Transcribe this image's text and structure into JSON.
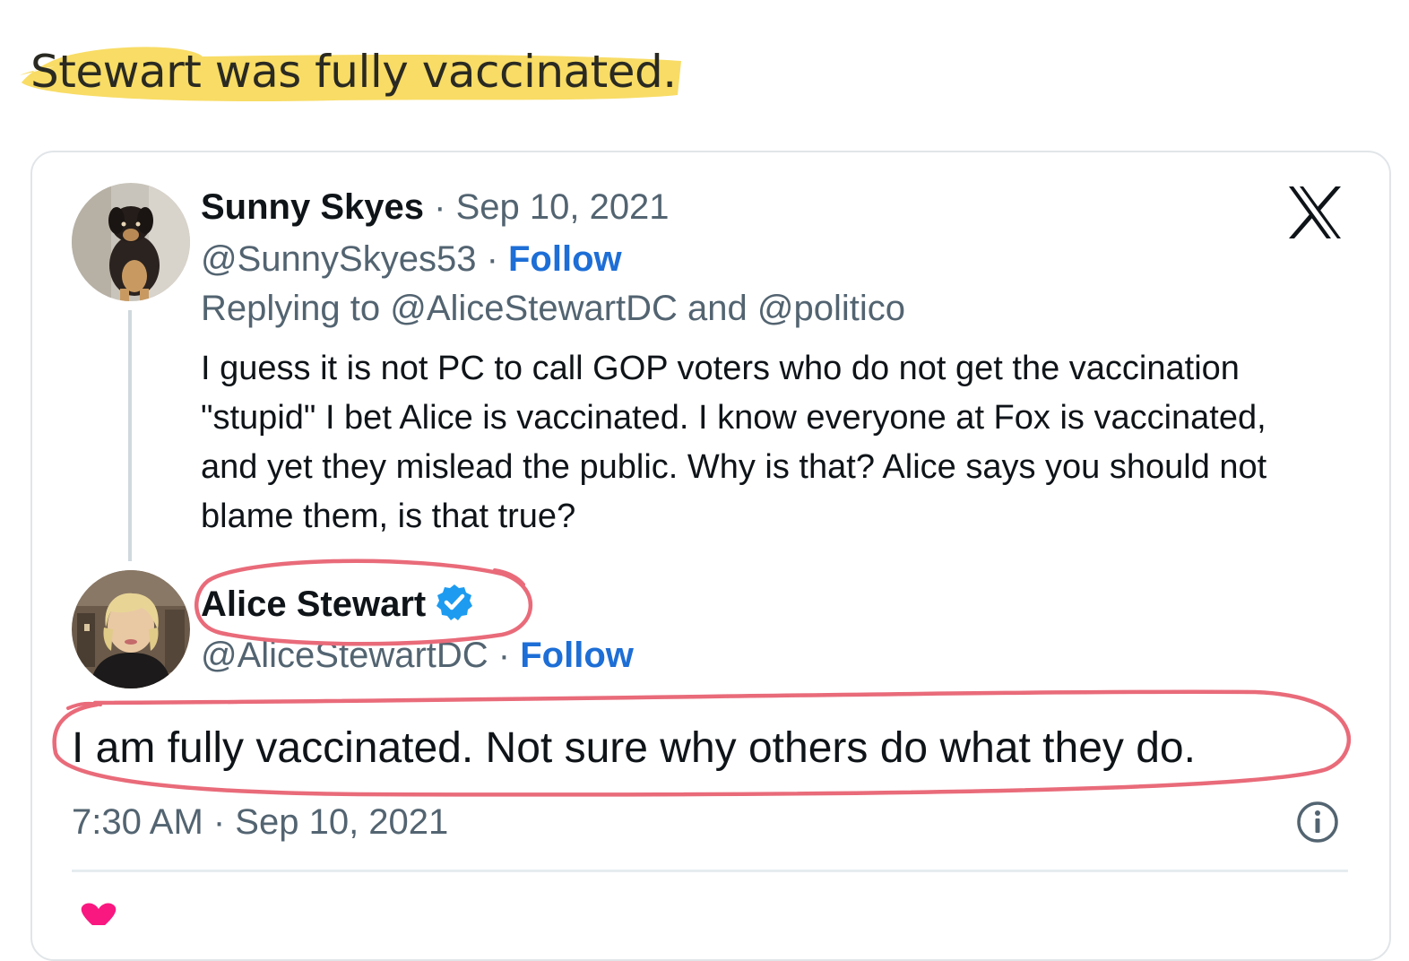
{
  "headline": "Stewart was fully vaccinated.",
  "colors": {
    "highlight": "#f7d64a",
    "annotation": "#e96b7a",
    "link": "#1d6ed6",
    "muted": "#536471"
  },
  "tweet": {
    "author_name": "Sunny Skyes",
    "date_sep": " · ",
    "date": "Sep 10, 2021",
    "handle": "@SunnySkyes53",
    "handle_sep": " · ",
    "follow_label": "Follow",
    "replying_to": "Replying to @AliceStewartDC and @politico",
    "text": "I guess it is not PC to call GOP voters who do not get the vaccination \"stupid\" I bet Alice is vaccinated. I know everyone at Fox is vaccinated, and yet they mislead the public. Why is that? Alice says you should not blame them, is that true?"
  },
  "reply": {
    "author_name": "Alice Stewart",
    "handle": "@AliceStewartDC",
    "handle_sep": " · ",
    "follow_label": "Follow",
    "text": "I am fully vaccinated. Not sure why others do what they do.",
    "timestamp": "7:30 AM · Sep 10, 2021"
  },
  "icons": {
    "platform": "x-logo-icon",
    "verified": "verified-badge-icon",
    "info": "info-icon",
    "like": "heart-icon"
  }
}
